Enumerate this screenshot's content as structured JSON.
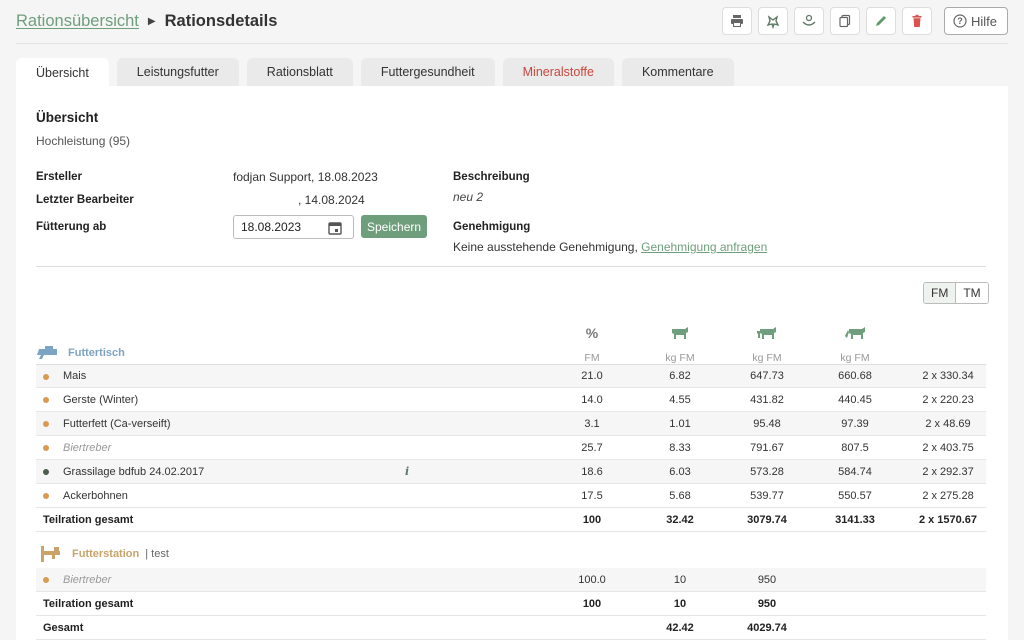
{
  "breadcrumb": {
    "parent": "Rationsübersicht",
    "current": "Rationsdetails"
  },
  "toolbar": {
    "icons": [
      "printer-icon",
      "cow-icon",
      "feeder-icon",
      "copy-icon",
      "edit-icon",
      "trash-icon"
    ],
    "help_label": "Hilfe"
  },
  "tabs": [
    {
      "label": "Übersicht",
      "active": true
    },
    {
      "label": "Leistungsfutter"
    },
    {
      "label": "Rationsblatt"
    },
    {
      "label": "Futtergesundheit"
    },
    {
      "label": "Mineralstoffe",
      "color": "#c9463d"
    },
    {
      "label": "Kommentare"
    }
  ],
  "overview": {
    "title": "Übersicht",
    "subtitle": "Hochleistung (95)",
    "creator_label": "Ersteller",
    "creator_value": "fodjan Support, 18.08.2023",
    "editor_label": "Letzter Bearbeiter",
    "editor_value": ", 14.08.2024",
    "feeding_label": "Fütterung ab",
    "feeding_date": "18.08.2023",
    "save_label": "Speichern",
    "description_label": "Beschreibung",
    "description_value": "neu 2",
    "approval_label": "Genehmigung",
    "approval_text": "Keine ausstehende Genehmigung,",
    "approval_link": "Genehmigung anfragen"
  },
  "toggle": {
    "fm": "FM",
    "tm": "TM"
  },
  "columns": {
    "percent": "%",
    "percent_unit": "FM",
    "unit": "kg FM"
  },
  "groups": {
    "futtertisch": {
      "label": "Futtertisch",
      "color": "#7ea4c4"
    },
    "futterstation": {
      "label": "Futterstation",
      "sub": "| test",
      "color": "#c9a36a"
    }
  },
  "rows_futtertisch": [
    {
      "name": "Mais",
      "pct": "21.0",
      "v1": "6.82",
      "v2": "647.73",
      "v3": "660.68",
      "v4": "2 x 330.34"
    },
    {
      "name": "Gerste (Winter)",
      "pct": "14.0",
      "v1": "4.55",
      "v2": "431.82",
      "v3": "440.45",
      "v4": "2 x 220.23"
    },
    {
      "name": "Futterfett (Ca-verseift)",
      "pct": "3.1",
      "v1": "1.01",
      "v2": "95.48",
      "v3": "97.39",
      "v4": "2 x 48.69"
    },
    {
      "name": "Biertreber",
      "pct": "25.7",
      "v1": "8.33",
      "v2": "791.67",
      "v3": "807.5",
      "v4": "2 x 403.75",
      "muted": true
    },
    {
      "name": "Grassilage bdfub 24.02.2017",
      "pct": "18.6",
      "v1": "6.03",
      "v2": "573.28",
      "v3": "584.74",
      "v4": "2 x 292.37",
      "dark": true,
      "info": "i"
    },
    {
      "name": "Ackerbohnen",
      "pct": "17.5",
      "v1": "5.68",
      "v2": "539.77",
      "v3": "550.57",
      "v4": "2 x 275.28"
    }
  ],
  "sum_futtertisch": {
    "name": "Teilration gesamt",
    "pct": "100",
    "v1": "32.42",
    "v2": "3079.74",
    "v3": "3141.33",
    "v4": "2 x 1570.67"
  },
  "rows_futterstation": [
    {
      "name": "Biertreber",
      "pct": "100.0",
      "v1": "10",
      "v2": "950",
      "muted": true
    }
  ],
  "sum_futterstation": {
    "name": "Teilration gesamt",
    "pct": "100",
    "v1": "10",
    "v2": "950"
  },
  "total": {
    "name": "Gesamt",
    "v1": "42.42",
    "v2": "4029.74"
  }
}
